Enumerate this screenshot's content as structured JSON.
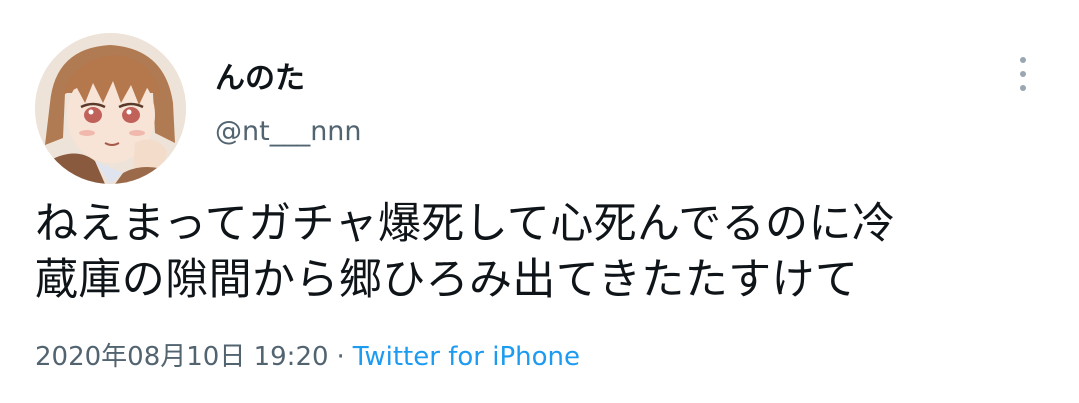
{
  "author": {
    "display_name": "んのた",
    "handle": "@nt___nnn",
    "avatar_icon": "anime-avatar-icon"
  },
  "tweet": {
    "text_lines": [
      "ねえまってガチャ爆死して心死んでるのに冷",
      "蔵庫の隙間から郷ひろみ出てきたたすけて"
    ],
    "timestamp": "2020年08月10日 19:20",
    "separator": "·",
    "source": "Twitter for iPhone"
  },
  "actions": {
    "more_icon": "more-vertical-icon"
  },
  "colors": {
    "text": "#0f1419",
    "secondary": "#536471",
    "link": "#1d9bf0"
  }
}
